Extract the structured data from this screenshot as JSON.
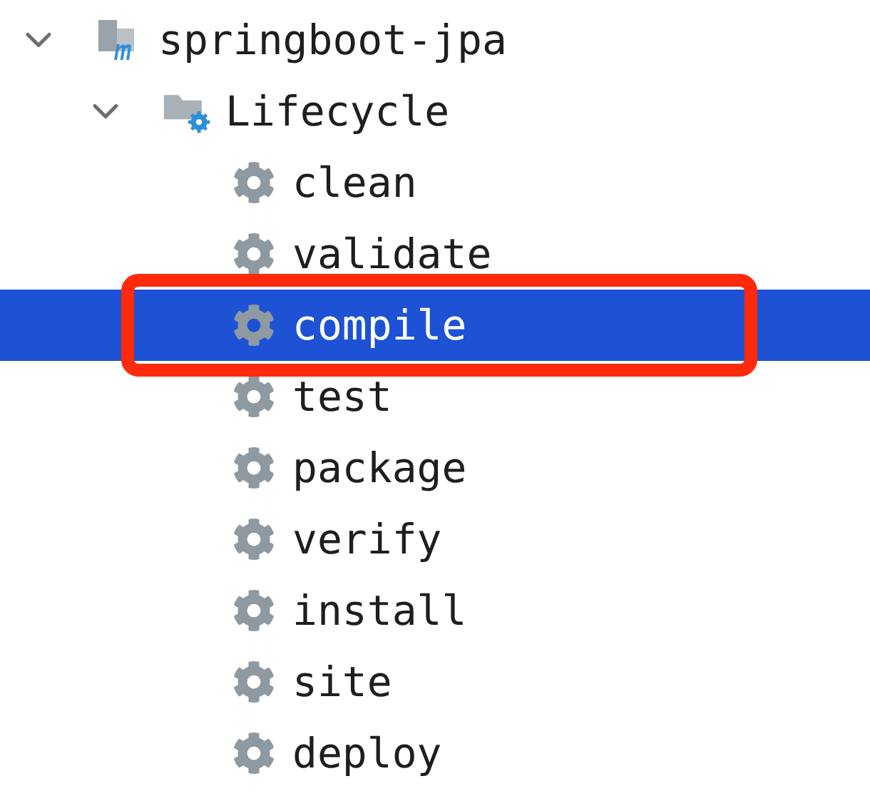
{
  "tree": [
    {
      "label": "springboot-jpa",
      "kind": "project",
      "expanded": true,
      "children": [
        {
          "label": "Lifecycle",
          "kind": "folder",
          "expanded": true,
          "children": [
            {
              "label": "clean",
              "kind": "goal",
              "selected": false
            },
            {
              "label": "validate",
              "kind": "goal",
              "selected": false
            },
            {
              "label": "compile",
              "kind": "goal",
              "selected": true
            },
            {
              "label": "test",
              "kind": "goal",
              "selected": false
            },
            {
              "label": "package",
              "kind": "goal",
              "selected": false
            },
            {
              "label": "verify",
              "kind": "goal",
              "selected": false
            },
            {
              "label": "install",
              "kind": "goal",
              "selected": false
            },
            {
              "label": "site",
              "kind": "goal",
              "selected": false
            },
            {
              "label": "deploy",
              "kind": "goal",
              "selected": false
            }
          ]
        }
      ]
    }
  ],
  "annotation": {
    "kind": "box"
  }
}
